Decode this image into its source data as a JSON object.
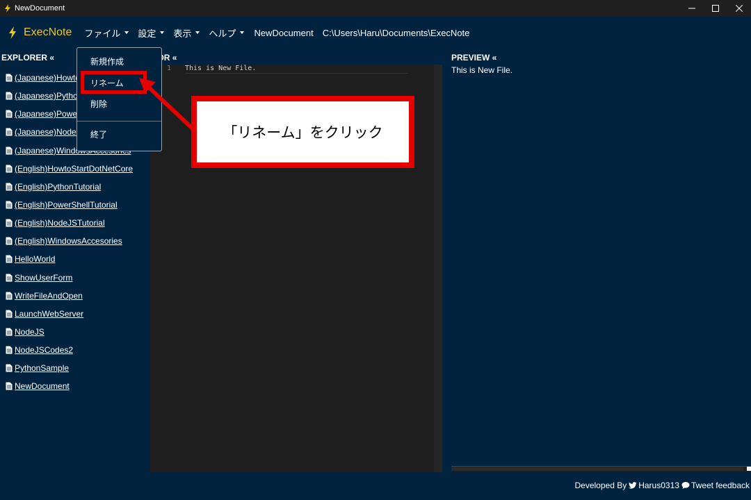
{
  "window": {
    "title": "NewDocument"
  },
  "brand": {
    "name": "ExecNote"
  },
  "menu": {
    "file": "ファイル",
    "settings": "設定",
    "view": "表示",
    "help": "ヘルプ"
  },
  "document": {
    "name": "NewDocument",
    "path": "C:\\Users\\Haru\\Documents\\ExecNote"
  },
  "explorer": {
    "header": "EXPLORER «",
    "files": [
      "(Japanese)HowtoStartDotNetCore",
      "(Japanese)PythonTutorial",
      "(Japanese)PowerShellTutorial",
      "(Japanese)NodeJSTutorial",
      "(Japanese)WindowsAccesories",
      "(English)HowtoStartDotNetCore",
      "(English)PythonTutorial",
      "(English)PowerShellTutorial",
      "(English)NodeJSTutorial",
      "(English)WindowsAccesories",
      "HelloWorld",
      "ShowUserForm",
      "WriteFileAndOpen",
      "LaunchWebServer",
      "NodeJS",
      "NodeJSCodes2",
      "PythonSample",
      "NewDocument"
    ]
  },
  "editor": {
    "header": "ITOR «",
    "line_number": "1",
    "line_text": "This is New File."
  },
  "preview": {
    "header": "PREVIEW «",
    "text": "This is New File."
  },
  "dropdown": {
    "items": [
      "新規作成",
      "リネーム",
      "削除",
      "終了"
    ]
  },
  "callout": {
    "text": "「リネーム」をクリック"
  },
  "footer": {
    "developed_by": "Developed By",
    "author": "Harus0313",
    "feedback": "Tweet feedback"
  },
  "colors": {
    "accent": "#f5c518",
    "annotation": "#e50000",
    "background": "#012340",
    "editor_bg": "#1e1e1e"
  }
}
